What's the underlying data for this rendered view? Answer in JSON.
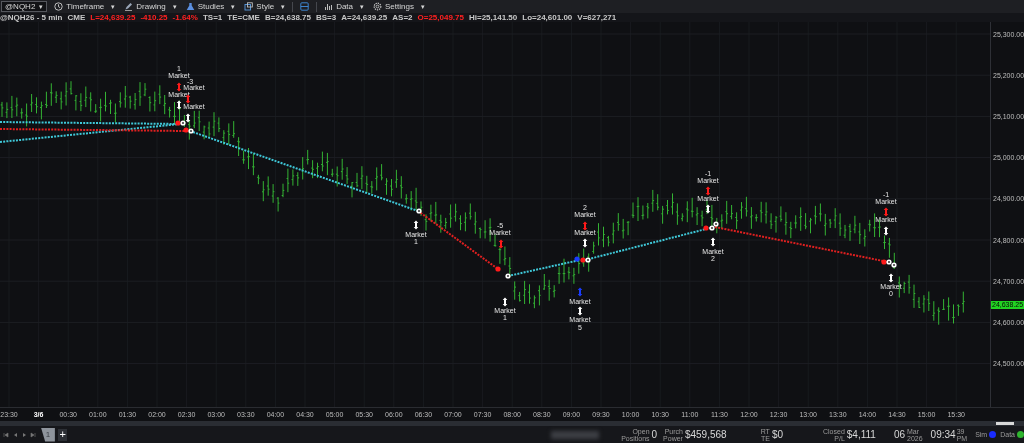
{
  "toolbar": {
    "symbol": "@NQH2",
    "symbol_caret": "▾",
    "menus": [
      {
        "kind": "clock",
        "label": "Timeframe",
        "caret": "▾"
      },
      {
        "kind": "pencil",
        "label": "Drawing",
        "caret": "▾"
      },
      {
        "kind": "flask",
        "label": "Studies",
        "caret": "▾"
      },
      {
        "kind": "style",
        "label": "Style",
        "caret": "▾"
      },
      {
        "kind": "layout"
      },
      {
        "kind": "bars",
        "label": "Data",
        "caret": "▾"
      },
      {
        "kind": "gear",
        "label": "Settings",
        "caret": "▾"
      }
    ]
  },
  "quote_line": [
    {
      "text": "@NQH26 - 5 min",
      "color": "#c8c8c8"
    },
    {
      "text": "CME",
      "color": "#c8c8c8"
    },
    {
      "text": "L=24,639.25",
      "color": "#ff2020"
    },
    {
      "text": "-410.25",
      "color": "#ff2020"
    },
    {
      "text": "-1.64%",
      "color": "#ff2020"
    },
    {
      "text": "TS=1",
      "color": "#c8c8c8"
    },
    {
      "text": "TE=CME",
      "color": "#c8c8c8"
    },
    {
      "text": "B=24,638.75",
      "color": "#c8c8c8"
    },
    {
      "text": "BS=3",
      "color": "#c8c8c8"
    },
    {
      "text": "A=24,639.25",
      "color": "#c8c8c8"
    },
    {
      "text": "AS=2",
      "color": "#c8c8c8"
    },
    {
      "text": "O=25,049.75",
      "color": "#ff2020"
    },
    {
      "text": "Hi=25,141.50",
      "color": "#c8c8c8"
    },
    {
      "text": "Lo=24,601.00",
      "color": "#c8c8c8"
    },
    {
      "text": "V=627,271",
      "color": "#c8c8c8"
    }
  ],
  "chart": {
    "price_labels": [
      "25,300.00",
      "25,200.00",
      "25,100.00",
      "25,000.00",
      "24,900.00",
      "24,800.00",
      "24,700.00",
      "24,600.00",
      "24,500.00"
    ],
    "current_price": "24,638.25",
    "time_labels": [
      {
        "text": "23:30",
        "date": false
      },
      {
        "text": "3/6",
        "date": true
      },
      {
        "text": "00:30",
        "date": false
      },
      {
        "text": "01:00",
        "date": false
      },
      {
        "text": "01:30",
        "date": false
      },
      {
        "text": "02:00",
        "date": false
      },
      {
        "text": "02:30",
        "date": false
      },
      {
        "text": "03:00",
        "date": false
      },
      {
        "text": "03:30",
        "date": false
      },
      {
        "text": "04:00",
        "date": false
      },
      {
        "text": "04:30",
        "date": false
      },
      {
        "text": "05:00",
        "date": false
      },
      {
        "text": "05:30",
        "date": false
      },
      {
        "text": "06:00",
        "date": false
      },
      {
        "text": "06:30",
        "date": false
      },
      {
        "text": "07:00",
        "date": false
      },
      {
        "text": "07:30",
        "date": false
      },
      {
        "text": "08:00",
        "date": false
      },
      {
        "text": "08:30",
        "date": false
      },
      {
        "text": "09:00",
        "date": false
      },
      {
        "text": "09:30",
        "date": false
      },
      {
        "text": "10:00",
        "date": false
      },
      {
        "text": "10:30",
        "date": false
      },
      {
        "text": "11:00",
        "date": false
      },
      {
        "text": "11:30",
        "date": false
      },
      {
        "text": "12:00",
        "date": false
      },
      {
        "text": "12:30",
        "date": false
      },
      {
        "text": "13:00",
        "date": false
      },
      {
        "text": "13:30",
        "date": false
      },
      {
        "text": "14:00",
        "date": false
      },
      {
        "text": "14:30",
        "date": false
      },
      {
        "text": "15:00",
        "date": false
      },
      {
        "text": "15:30",
        "date": false
      }
    ],
    "trade_lines": [
      {
        "color": "#3fc8d8"
      },
      {
        "color": "#3fc8d8"
      },
      {
        "color": "#e02020"
      },
      {
        "color": "#3fc8d8"
      },
      {
        "color": "#e02020"
      },
      {
        "color": "#3fc8d8"
      },
      {
        "color": "#3fc8d8"
      },
      {
        "color": "#e02020"
      }
    ],
    "fill_dots": [
      {
        "color": "#ff1a1a"
      },
      {
        "color": "#ffffff"
      },
      {
        "color": "#ff1a1a"
      },
      {
        "color": "#ffffff"
      },
      {
        "color": "#ffffff"
      },
      {
        "color": "#ff1a1a"
      },
      {
        "color": "#ffffff"
      },
      {
        "color": "#1a3cff"
      },
      {
        "color": "#ff1a1a"
      },
      {
        "color": "#ffffff"
      },
      {
        "color": "#ff1a1a"
      },
      {
        "color": "#ffffff"
      },
      {
        "color": "#ffffff"
      },
      {
        "color": "#ff1a1a"
      },
      {
        "color": "#ffffff"
      },
      {
        "color": "#ffffff"
      }
    ],
    "annotations": [
      {
        "kind": "text",
        "text": "1"
      },
      {
        "kind": "text",
        "text": "Market"
      },
      {
        "kind": "text",
        "text": "-3"
      },
      {
        "kind": "arrow",
        "color": "#ff1a1a"
      },
      {
        "kind": "text",
        "text": "Market"
      },
      {
        "kind": "text",
        "text": "Market"
      },
      {
        "kind": "arrow",
        "color": "#ff1a1a"
      },
      {
        "kind": "arrow",
        "color": "#ffffff"
      },
      {
        "kind": "text",
        "text": "Market"
      },
      {
        "kind": "arrow",
        "color": "#ffffff"
      },
      {
        "kind": "arrow",
        "color": "#ffffff"
      },
      {
        "kind": "text",
        "text": "Market"
      },
      {
        "kind": "text",
        "text": "1"
      },
      {
        "kind": "text",
        "text": "-5"
      },
      {
        "kind": "text",
        "text": "Market"
      },
      {
        "kind": "arrow",
        "color": "#ff1a1a"
      },
      {
        "kind": "arrow",
        "color": "#ffffff"
      },
      {
        "kind": "text",
        "text": "Market"
      },
      {
        "kind": "text",
        "text": "1"
      },
      {
        "kind": "text",
        "text": "2"
      },
      {
        "kind": "text",
        "text": "Market"
      },
      {
        "kind": "arrow",
        "color": "#ff1a1a"
      },
      {
        "kind": "text",
        "text": "Market"
      },
      {
        "kind": "arrow",
        "color": "#ffffff"
      },
      {
        "kind": "arrow",
        "color": "#1a3cff"
      },
      {
        "kind": "text",
        "text": "Market"
      },
      {
        "kind": "arrow",
        "color": "#ffffff"
      },
      {
        "kind": "text",
        "text": "Market"
      },
      {
        "kind": "text",
        "text": "5"
      },
      {
        "kind": "text",
        "text": "-1"
      },
      {
        "kind": "text",
        "text": "Market"
      },
      {
        "kind": "arrow",
        "color": "#ff1a1a"
      },
      {
        "kind": "text",
        "text": "Market"
      },
      {
        "kind": "arrow",
        "color": "#ffffff"
      },
      {
        "kind": "arrow",
        "color": "#ffffff"
      },
      {
        "kind": "text",
        "text": "Market"
      },
      {
        "kind": "text",
        "text": "2"
      },
      {
        "kind": "text",
        "text": "-1"
      },
      {
        "kind": "text",
        "text": "Market"
      },
      {
        "kind": "arrow",
        "color": "#ff1a1a"
      },
      {
        "kind": "text",
        "text": "Market"
      },
      {
        "kind": "arrow",
        "color": "#ffffff"
      },
      {
        "kind": "arrow",
        "color": "#ffffff"
      },
      {
        "kind": "text",
        "text": "Market"
      },
      {
        "kind": "text",
        "text": "0"
      }
    ]
  },
  "bottom_bar": {
    "tabs": [
      {
        "label": "1",
        "selected": true
      }
    ],
    "add_tab": "+",
    "stats": [
      {
        "label_top": "Open",
        "label_bottom": "Positions",
        "value": "0"
      },
      {
        "label_top": "Purch",
        "label_bottom": "Power",
        "value": "$459,568"
      },
      {
        "label_top": "RT",
        "label_bottom": "TE",
        "value": "$0"
      },
      {
        "label_top": "Closed",
        "label_bottom": "P/L",
        "value": "$4,111"
      }
    ],
    "date": {
      "day": "06",
      "month": "Mar",
      "year": "2026"
    },
    "time": {
      "clock": "09:34",
      "seconds": "39",
      "ampm": "PM"
    },
    "status": [
      {
        "label": "Sim",
        "color": "#1a2cff"
      },
      {
        "label": "Data",
        "color": "#2fb52f"
      }
    ]
  }
}
